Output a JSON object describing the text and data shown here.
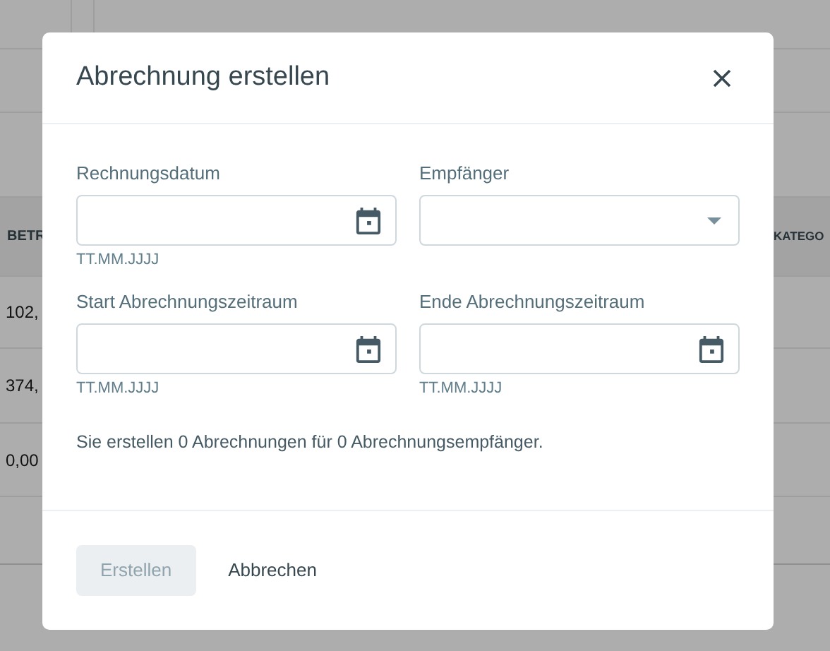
{
  "background_table": {
    "left_column": {
      "header": "BETR",
      "cells": [
        "102,",
        "374,",
        "0,00"
      ]
    },
    "right_column": {
      "header": "KATEGO"
    }
  },
  "dialog": {
    "title": "Abrechnung erstellen",
    "fields": [
      {
        "kind": "date",
        "label": "Rechnungsdatum",
        "hint": "TT.MM.JJJJ"
      },
      {
        "kind": "select",
        "label": "Empfänger"
      },
      {
        "kind": "date",
        "label": "Start Abrechnungszeitraum",
        "hint": "TT.MM.JJJJ"
      },
      {
        "kind": "date",
        "label": "Ende Abrechnungszeitraum",
        "hint": "TT.MM.JJJJ"
      }
    ],
    "summary": "Sie erstellen 0 Abrechnungen für 0 Abrechnungsempfänger.",
    "buttons": [
      {
        "label": "Erstellen",
        "disabled": true
      },
      {
        "label": "Abbrechen",
        "disabled": false
      }
    ]
  }
}
